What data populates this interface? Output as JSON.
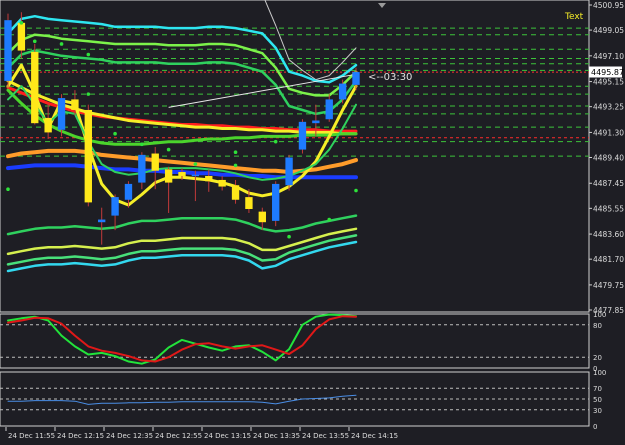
{
  "chart_data": {
    "type": "candlestick",
    "main": {
      "price_ticks": [
        4500.95,
        4499.05,
        4497.1,
        4495.15,
        4493.25,
        4491.3,
        4489.4,
        4487.45,
        4485.55,
        4483.6,
        4481.7,
        4479.75,
        4477.85
      ],
      "ylim": [
        4477.85,
        4500.95
      ],
      "current_price": "4495.87",
      "countdown": "<--03:30",
      "text_label": "Text",
      "bars": [
        {
          "o": 4495.2,
          "h": 4500.3,
          "l": 4494.6,
          "c": 4499.8
        },
        {
          "o": 4499.6,
          "h": 4500.4,
          "l": 4496.9,
          "c": 4497.5
        },
        {
          "o": 4497.4,
          "h": 4498.0,
          "l": 4491.9,
          "c": 4492.0
        },
        {
          "o": 4492.4,
          "h": 4493.5,
          "l": 4490.8,
          "c": 4491.3
        },
        {
          "o": 4491.5,
          "h": 4494.2,
          "l": 4491.0,
          "c": 4493.9
        },
        {
          "o": 4493.8,
          "h": 4494.5,
          "l": 4492.6,
          "c": 4493.0
        },
        {
          "o": 4493.0,
          "h": 4493.4,
          "l": 4485.7,
          "c": 4486.0
        },
        {
          "o": 4484.5,
          "h": 4485.6,
          "l": 4482.8,
          "c": 4484.7
        },
        {
          "o": 4485.0,
          "h": 4486.6,
          "l": 4483.9,
          "c": 4486.4
        },
        {
          "o": 4486.2,
          "h": 4487.6,
          "l": 4485.6,
          "c": 4487.4
        },
        {
          "o": 4487.5,
          "h": 4489.8,
          "l": 4487.0,
          "c": 4489.6
        },
        {
          "o": 4489.7,
          "h": 4490.2,
          "l": 4487.0,
          "c": 4488.4
        },
        {
          "o": 4488.5,
          "h": 4488.7,
          "l": 4485.2,
          "c": 4487.5
        },
        {
          "o": 4488.3,
          "h": 4488.6,
          "l": 4487.7,
          "c": 4488.0
        },
        {
          "o": 4488.0,
          "h": 4488.4,
          "l": 4486.1,
          "c": 4488.1
        },
        {
          "o": 4488.0,
          "h": 4488.5,
          "l": 4486.8,
          "c": 4487.6
        },
        {
          "o": 4487.7,
          "h": 4488.0,
          "l": 4486.9,
          "c": 4487.2
        },
        {
          "o": 4487.3,
          "h": 4487.7,
          "l": 4485.9,
          "c": 4486.2
        },
        {
          "o": 4486.4,
          "h": 4487.0,
          "l": 4485.2,
          "c": 4485.5
        },
        {
          "o": 4485.3,
          "h": 4485.6,
          "l": 4483.9,
          "c": 4484.5
        },
        {
          "o": 4484.6,
          "h": 4487.6,
          "l": 4484.2,
          "c": 4487.4
        },
        {
          "o": 4487.3,
          "h": 4489.6,
          "l": 4486.9,
          "c": 4489.4
        },
        {
          "o": 4490.0,
          "h": 4492.3,
          "l": 4489.7,
          "c": 4492.1
        },
        {
          "o": 4492.0,
          "h": 4493.4,
          "l": 4491.0,
          "c": 4492.2
        },
        {
          "o": 4492.3,
          "h": 4494.2,
          "l": 4492.1,
          "c": 4493.8
        },
        {
          "o": 4493.8,
          "h": 4495.3,
          "l": 4493.5,
          "c": 4495.0
        },
        {
          "o": 4494.9,
          "h": 4496.2,
          "l": 4494.5,
          "c": 4495.87
        }
      ],
      "upper_bands": [
        {
          "color": "#2ee6f0",
          "values": [
            4498.8,
            4499.9,
            4500.1,
            4499.9,
            4499.8,
            4499.7,
            4499.6,
            4499.5,
            4499.3,
            4499.3,
            4499.3,
            4499.3,
            4499.2,
            4499.2,
            4499.2,
            4499.3,
            4499.3,
            4499.2,
            4499.0,
            4498.8,
            4497.7,
            4495.9,
            4495.6,
            4495.2,
            4495.1,
            4495.6,
            4496.4
          ]
        },
        {
          "color": "#7cf24a",
          "values": [
            4497.3,
            4498.3,
            4498.7,
            4498.6,
            4498.4,
            4498.3,
            4498.2,
            4498.1,
            4498.0,
            4498.0,
            4498.0,
            4498.0,
            4497.9,
            4497.9,
            4497.9,
            4498.0,
            4498.0,
            4497.9,
            4497.6,
            4497.3,
            4496.2,
            4494.6,
            4494.3,
            4494.1,
            4494.1,
            4494.9,
            4495.9
          ]
        },
        {
          "color": "#2fd15e",
          "values": [
            4496.2,
            4497.2,
            4497.5,
            4497.3,
            4497.1,
            4497.0,
            4496.9,
            4496.8,
            4496.6,
            4496.6,
            4496.6,
            4496.6,
            4496.5,
            4496.5,
            4496.5,
            4496.6,
            4496.6,
            4496.5,
            4496.2,
            4495.9,
            4494.9,
            4493.3,
            4493.0,
            4492.7,
            4492.9,
            4493.8,
            4495.2
          ]
        }
      ],
      "lower_bands": [
        {
          "color": "#2fd15e",
          "values": [
            4483.6,
            4483.8,
            4484.0,
            4484.1,
            4484.1,
            4484.2,
            4484.1,
            4484.0,
            4484.1,
            4484.4,
            4484.6,
            4484.6,
            4484.7,
            4484.8,
            4484.8,
            4484.8,
            4484.8,
            4484.7,
            4484.4,
            4484.0,
            4483.8,
            4483.9,
            4484.1,
            4484.4,
            4484.6,
            4484.8,
            4485.0
          ]
        },
        {
          "color": "#d6f04e",
          "values": [
            4482.1,
            4482.3,
            4482.5,
            4482.6,
            4482.6,
            4482.7,
            4482.6,
            4482.5,
            4482.6,
            4482.9,
            4483.1,
            4483.1,
            4483.2,
            4483.3,
            4483.3,
            4483.3,
            4483.3,
            4483.2,
            4482.9,
            4482.4,
            4482.4,
            4482.7,
            4483.0,
            4483.3,
            4483.6,
            4483.8,
            4484.0
          ]
        },
        {
          "color": "#48e07a",
          "values": [
            4481.3,
            4481.5,
            4481.7,
            4481.8,
            4481.8,
            4481.9,
            4481.8,
            4481.7,
            4481.8,
            4482.1,
            4482.3,
            4482.3,
            4482.4,
            4482.5,
            4482.5,
            4482.5,
            4482.5,
            4482.4,
            4482.1,
            4481.6,
            4481.7,
            4482.2,
            4482.5,
            4482.8,
            4483.1,
            4483.3,
            4483.5
          ]
        },
        {
          "color": "#33d8ee",
          "values": [
            4480.8,
            4481.0,
            4481.2,
            4481.3,
            4481.3,
            4481.4,
            4481.3,
            4481.2,
            4481.3,
            4481.6,
            4481.8,
            4481.8,
            4481.9,
            4482.0,
            4482.0,
            4482.0,
            4482.0,
            4481.9,
            4481.6,
            4481.0,
            4481.2,
            4481.7,
            4482.0,
            4482.3,
            4482.6,
            4482.8,
            4483.0
          ]
        }
      ],
      "envelope": {
        "color": "#c9c9c9",
        "values": [
          4502.6,
          4503.2,
          4503.4,
          4503.3,
          4503.2,
          4503.1,
          4503.0,
          4502.9,
          4502.8,
          4502.8,
          4502.8,
          4502.8,
          4502.7,
          4502.7,
          4502.7,
          4502.8,
          4502.8,
          4502.7,
          4502.4,
          4501.8,
          4499.4,
          4496.8,
          4496.0,
          4495.3,
          4495.6,
          4496.6,
          4497.7
        ]
      },
      "ma_lines": [
        {
          "color": "#ff1e1e",
          "width": 3,
          "values": [
            4494.7,
            4494.3,
            4493.9,
            4493.5,
            4493.2,
            4492.9,
            4492.7,
            4492.5,
            4492.4,
            4492.3,
            4492.2,
            4492.1,
            4492.0,
            4491.9,
            4491.9,
            4491.8,
            4491.8,
            4491.7,
            4491.7,
            4491.6,
            4491.6,
            4491.5,
            4491.5,
            4491.5,
            4491.4,
            4491.4,
            4491.4
          ]
        },
        {
          "color": "#f6ee28",
          "width": 3,
          "values": [
            4495.2,
            4494.7,
            4494.2,
            4493.8,
            4493.4,
            4493.1,
            4492.8,
            4492.6,
            4492.4,
            4492.2,
            4492.1,
            4492.0,
            4491.9,
            4491.8,
            4491.7,
            4491.7,
            4491.6,
            4491.6,
            4491.5,
            4491.5,
            4491.4,
            4491.4,
            4491.3,
            4491.3,
            4491.3,
            4491.2,
            4491.2
          ]
        },
        {
          "color": "#4bd42c",
          "width": 3,
          "values": [
            4494.5,
            4493.5,
            4492.6,
            4491.9,
            4491.4,
            4491.0,
            4490.7,
            4490.5,
            4490.4,
            4490.4,
            4490.4,
            4490.5,
            4490.6,
            4490.6,
            4490.7,
            4490.8,
            4490.8,
            4490.9,
            4490.9,
            4491.0,
            4491.0,
            4491.0,
            4491.1,
            4491.1,
            4491.1,
            4491.2,
            4491.2
          ]
        },
        {
          "color": "#ff9c2a",
          "width": 4,
          "values": [
            4489.5,
            4489.7,
            4489.8,
            4489.9,
            4489.9,
            4489.9,
            4489.8,
            4489.6,
            4489.5,
            4489.4,
            4489.3,
            4489.2,
            4489.1,
            4489.0,
            4488.9,
            4488.8,
            4488.7,
            4488.6,
            4488.5,
            4488.4,
            4488.4,
            4488.3,
            4488.4,
            4488.5,
            4488.7,
            4488.9,
            4489.2
          ]
        },
        {
          "color": "#1a3cff",
          "width": 4,
          "values": [
            4488.6,
            4488.7,
            4488.8,
            4488.8,
            4488.8,
            4488.8,
            4488.7,
            4488.6,
            4488.5,
            4488.5,
            4488.4,
            4488.4,
            4488.3,
            4488.3,
            4488.2,
            4488.2,
            4488.1,
            4488.1,
            4488.0,
            4488.0,
            4487.9,
            4487.9,
            4487.9,
            4487.9,
            4487.9,
            4487.9,
            4487.9
          ]
        },
        {
          "color": "#f6ee28",
          "width": 3,
          "values": [
            4494.8,
            4496.4,
            4494.2,
            4491.6,
            4493.7,
            4493.5,
            4490.2,
            4487.4,
            4486.2,
            4485.8,
            4486.6,
            4487.5,
            4487.9,
            4487.9,
            4487.8,
            4487.7,
            4487.5,
            4487.2,
            4486.7,
            4486.5,
            4486.7,
            4487.2,
            4488.0,
            4489.1,
            4491.0,
            4493.0,
            4494.8
          ]
        },
        {
          "color": "#2fd15e",
          "width": 2,
          "values": [
            4493.8,
            4494.8,
            4493.4,
            4492.0,
            4492.9,
            4492.7,
            4490.6,
            4488.9,
            4488.3,
            4488.1,
            4488.2,
            4488.5,
            4488.6,
            4488.6,
            4488.6,
            4488.5,
            4488.4,
            4488.2,
            4487.9,
            4487.7,
            4487.8,
            4488.0,
            4488.4,
            4488.9,
            4490.0,
            4491.6,
            4493.4
          ]
        }
      ],
      "dots": [
        {
          "i": 1,
          "v": 4499.6
        },
        {
          "i": 2,
          "v": 4498.2
        },
        {
          "i": 4,
          "v": 4498.0
        },
        {
          "i": 6,
          "v": 4497.2
        },
        {
          "i": 0,
          "v": 4487.0
        },
        {
          "i": 6,
          "v": 4494.2
        },
        {
          "i": 8,
          "v": 4491.2
        },
        {
          "i": 10,
          "v": 4490.4
        },
        {
          "i": 12,
          "v": 4490.0
        },
        {
          "i": 14,
          "v": 4488.9
        },
        {
          "i": 17,
          "v": 4488.8
        },
        {
          "i": 20,
          "v": 4490.6
        },
        {
          "i": 24,
          "v": 4484.7
        },
        {
          "i": 26,
          "v": 4486.9
        },
        {
          "i": 21,
          "v": 4483.4
        },
        {
          "i": 17,
          "v": 4489.8
        }
      ],
      "resistance_levels": [
        4499.2,
        4498.7,
        4497.6,
        4496.9,
        4496.5,
        4496.0,
        4494.8,
        4494.2,
        4493.3,
        4492.7,
        4491.7,
        4490.6,
        4489.5
      ],
      "support_levels": [
        4490.9
      ]
    },
    "time_labels": [
      "24 Dec 11:55",
      "24 Dec 12:15",
      "24 Dec 12:35",
      "24 Dec 12:55",
      "24 Dec 13:15",
      "24 Dec 13:35",
      "24 Dec 13:55",
      "24 Dec 14:15"
    ],
    "stochastic": {
      "levels": [
        "100",
        "80",
        "20",
        "0"
      ],
      "ylim": [
        0,
        100
      ],
      "main": {
        "color": "#22e33b",
        "values": [
          88,
          92,
          95,
          88,
          60,
          40,
          25,
          28,
          22,
          12,
          8,
          16,
          38,
          52,
          45,
          38,
          32,
          40,
          42,
          30,
          14,
          35,
          80,
          95,
          99,
          98,
          96
        ]
      },
      "signal": {
        "color": "#e01818",
        "values": [
          84,
          88,
          93,
          92,
          82,
          60,
          40,
          32,
          28,
          22,
          14,
          12,
          20,
          34,
          44,
          46,
          40,
          36,
          40,
          42,
          34,
          26,
          42,
          72,
          90,
          96,
          95
        ]
      }
    },
    "rsi": {
      "levels": [
        "100",
        "70",
        "50",
        "30",
        "0"
      ],
      "ylim": [
        0,
        100
      ],
      "line": {
        "color": "#4a8ee6",
        "values": [
          46,
          46,
          47,
          47,
          47,
          46,
          40,
          42,
          42,
          43,
          43,
          44,
          44,
          45,
          45,
          45,
          45,
          45,
          45,
          44,
          41,
          46,
          50,
          51,
          52,
          55,
          57
        ]
      }
    }
  }
}
